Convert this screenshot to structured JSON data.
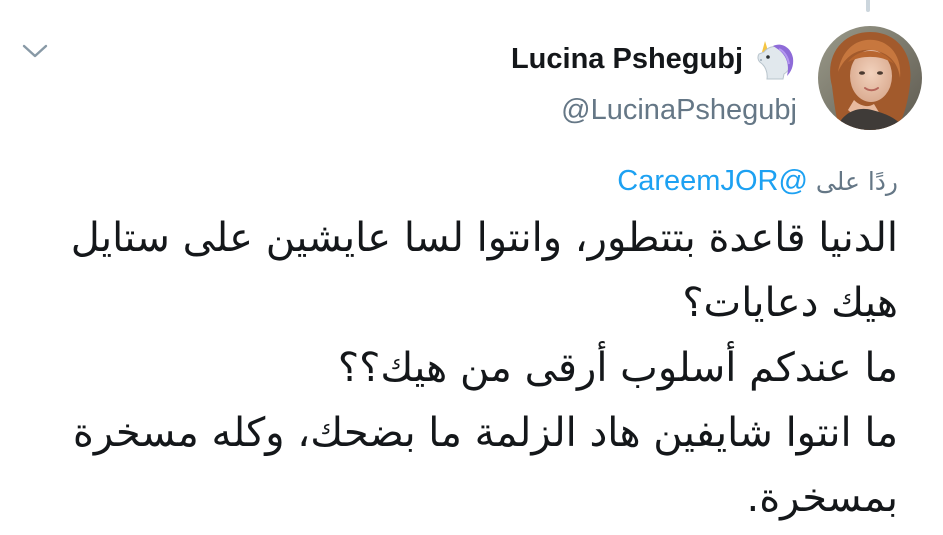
{
  "user": {
    "display_name": "Lucina Pshegubj",
    "handle": "@LucinaPshegubj",
    "name_emoji": "unicorn-icon"
  },
  "reply": {
    "prefix": "ردًا على",
    "mention": "@CareemJOR"
  },
  "tweet": {
    "paragraphs": [
      "الدنيا قاعدة بتتطور، وانتوا لسا عايشين على ستايل\nهيك دعايات؟",
      "ما عندكم أسلوب أرقى من هيك؟؟",
      "ما انتوا شايفين هاد الزلمة ما بضحك، وكله مسخرة\nبمسخرة."
    ]
  },
  "colors": {
    "text": "#14171a",
    "secondary": "#657786",
    "link": "#1da1f2",
    "divider": "#ccd6dd"
  }
}
